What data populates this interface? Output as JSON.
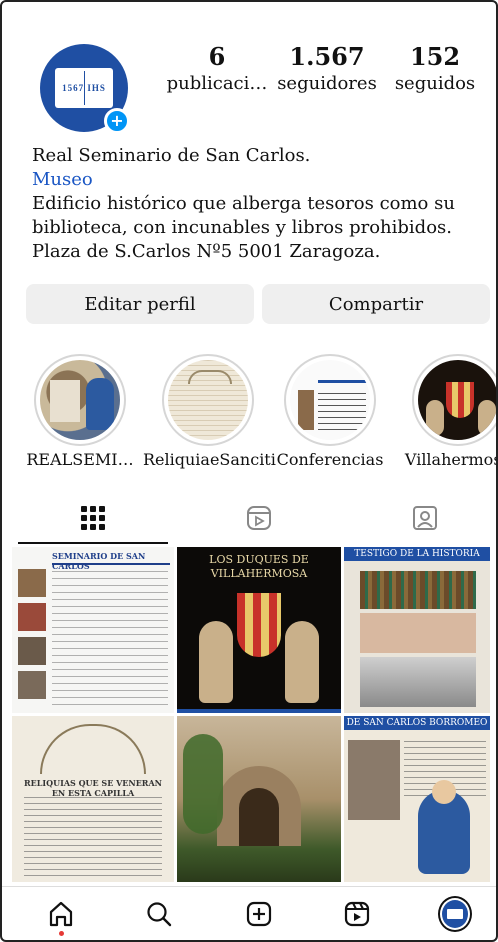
{
  "profile": {
    "avatar_text": "1567 IHS",
    "stats": {
      "posts": {
        "value": "6",
        "label": "publicaci…"
      },
      "followers": {
        "value": "1.567",
        "label": "seguidores"
      },
      "following": {
        "value": "152",
        "label": "seguidos"
      }
    },
    "name": "Real Seminario de San Carlos.",
    "category": "Museo",
    "bio_lines": [
      "Edificio histórico que alberga tesoros como su",
      "biblioteca, con incunables y libros prohibidos.",
      "Plaza de S.Carlos Nº5 5001 Zaragoza."
    ]
  },
  "actions": {
    "edit": "Editar perfil",
    "share": "Compartir"
  },
  "highlights": [
    {
      "name": "REALSEMI…"
    },
    {
      "name": "ReliquiaeSanciti"
    },
    {
      "name": "Conferencias"
    },
    {
      "name": "Villahermosa"
    }
  ],
  "posts": {
    "p1_title": "SEMINARIO DE SAN CARLOS",
    "p2_title": "LOS DUQUES DE VILLAHERMOSA",
    "p3_title": "TESTIGO DE LA HISTORIA",
    "p4_title": "RELIQUIAS QUE SE VENERAN EN ESTA CAPILLA",
    "p6_title": "DE SAN CARLOS BORROMEO"
  },
  "colors": {
    "accent": "#0095f6",
    "brand": "#1f4fa3",
    "link": "#1a56c4"
  }
}
